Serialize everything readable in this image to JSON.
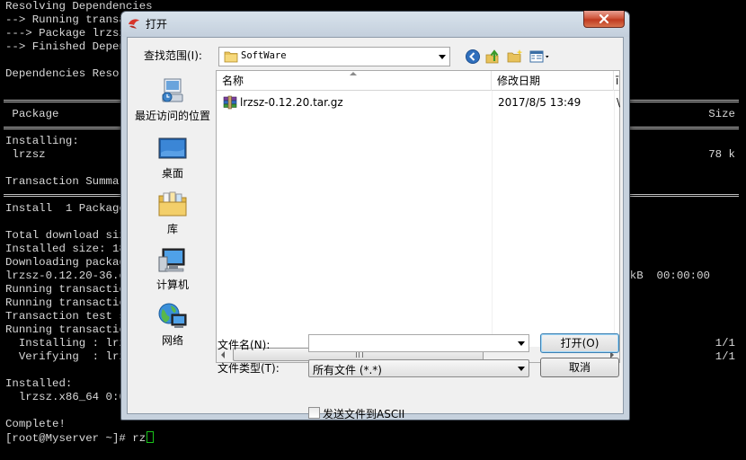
{
  "terminal": {
    "lines": [
      "Resolving Dependencies",
      "--> Running transa",
      "---> Package lrzsz",
      "--> Finished Depen",
      "",
      "Dependencies Resol",
      "",
      "",
      " Package",
      "",
      "Installing:",
      " lrzsz",
      "",
      "Transaction Summar",
      "",
      "Install  1 Package",
      "",
      "Total download siz",
      "Installed size: 18",
      "Downloading packag",
      "lrzsz-0.12.20-36.e",
      "Running transactio",
      "Running transactio",
      "Transaction test s",
      "Running transactio",
      "  Installing : lrz",
      "  Verifying  : lrz",
      "",
      "Installed:",
      "  lrzsz.x86_64 0:0",
      "",
      "Complete!",
      "[root@Myserver ~]# rz"
    ],
    "right_size_header": "Size",
    "right_size_value": "78 k",
    "right_download": "kB  00:00:00",
    "right_install_count": "1/1",
    "right_verify_count": "1/1",
    "cursor_color": "#18c41a"
  },
  "dialog": {
    "title": "打开",
    "lookin_label": "查找范围(I):",
    "lookin_value": "SoftWare",
    "places": [
      {
        "label": "最近访问的位置",
        "icon": "recent-places-icon"
      },
      {
        "label": "桌面",
        "icon": "desktop-icon"
      },
      {
        "label": "库",
        "icon": "libraries-icon"
      },
      {
        "label": "计算机",
        "icon": "computer-icon"
      },
      {
        "label": "网络",
        "icon": "network-icon"
      }
    ],
    "columns": {
      "name": "名称",
      "date": "修改日期",
      "extra": "ī"
    },
    "files": [
      {
        "name": "lrzsz-0.12.20.tar.gz",
        "date": "2017/8/5 13:49",
        "trunc": "\\",
        "icon": "archive-icon"
      }
    ],
    "filename_label": "文件名(N):",
    "filename_value": "",
    "filetype_label": "文件类型(T):",
    "filetype_value": "所有文件 (*.*)",
    "open_button": "打开(O)",
    "cancel_button": "取消",
    "ascii_label": "发送文件到ASCII",
    "ascii_checked": false
  }
}
